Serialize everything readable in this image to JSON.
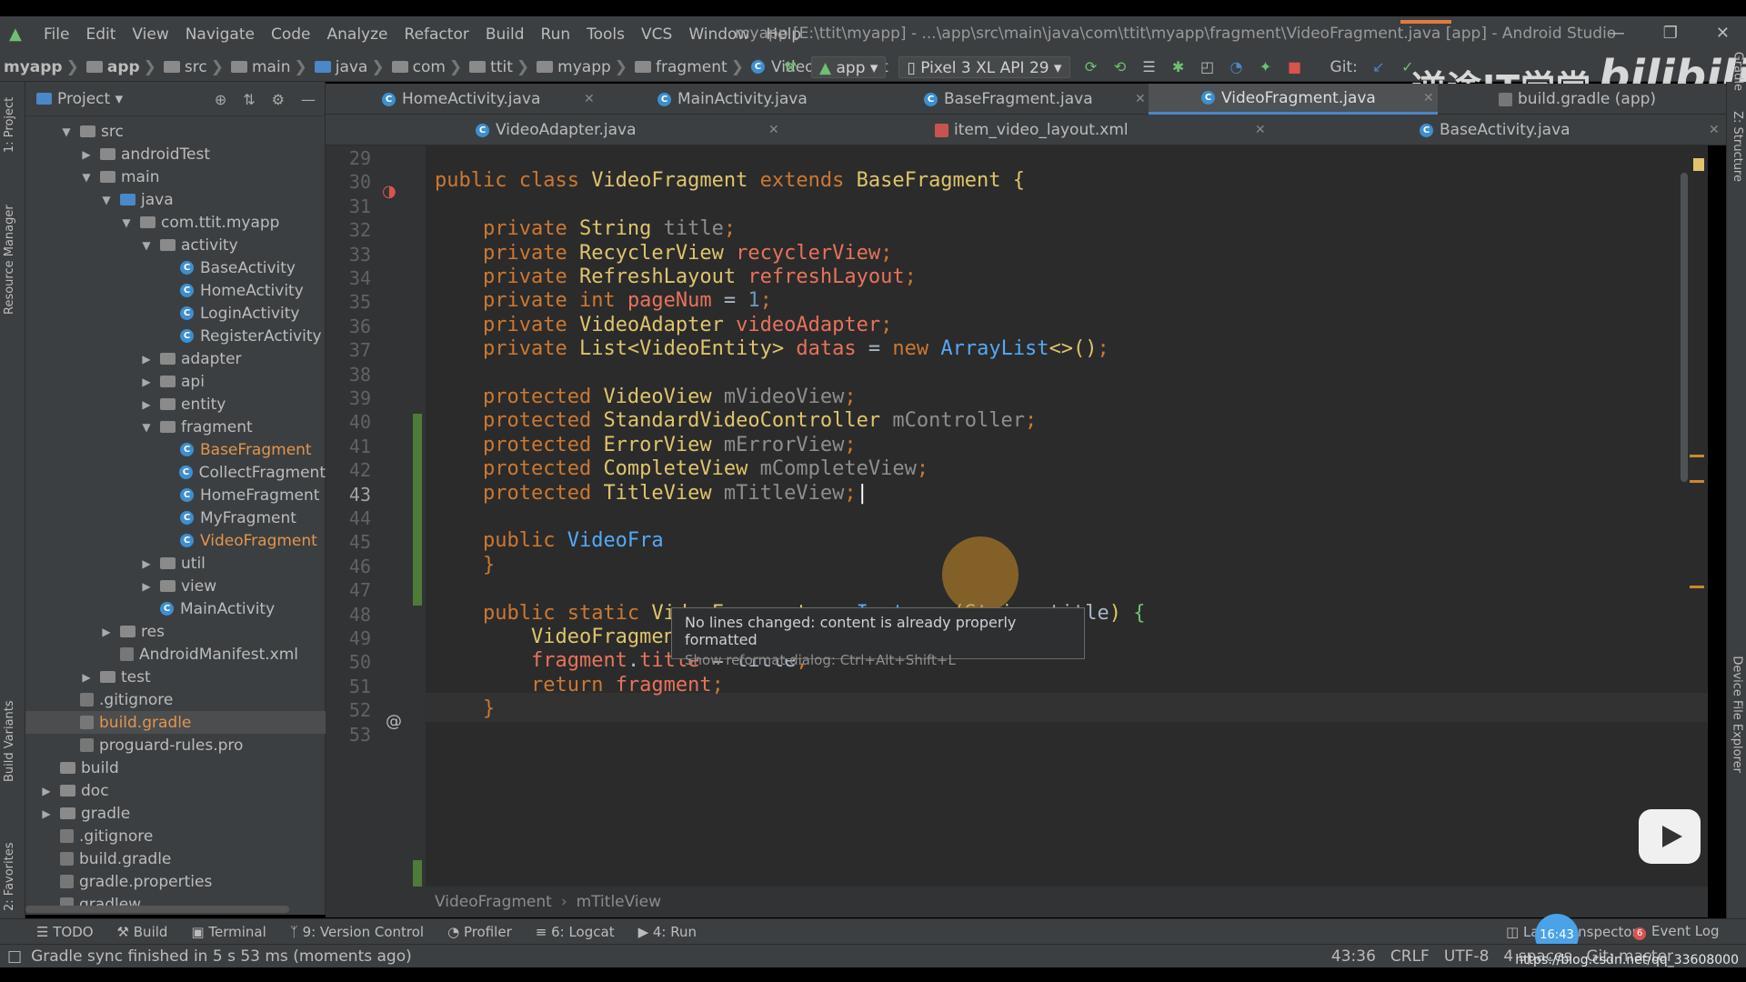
{
  "menu": [
    "File",
    "Edit",
    "View",
    "Navigate",
    "Code",
    "Analyze",
    "Refactor",
    "Build",
    "Run",
    "Tools",
    "VCS",
    "Window",
    "Help"
  ],
  "window_title": "myapp [E:\\ttit\\myapp] - ...\\app\\src\\main\\java\\com\\ttit\\myapp\\fragment\\VideoFragment.java [app] - Android Studio",
  "nav_crumbs": [
    "myapp",
    "app",
    "src",
    "main",
    "java",
    "com",
    "ttit",
    "myapp",
    "fragment",
    "VideoFragment"
  ],
  "run_config": "app",
  "device": "Pixel 3 XL API 29",
  "git_label": "Git:",
  "project_panel": {
    "title": "Project",
    "tree": [
      {
        "label": "src",
        "depth": 0,
        "kind": "folder",
        "state": "open"
      },
      {
        "label": "androidTest",
        "depth": 1,
        "kind": "folder",
        "state": "closed"
      },
      {
        "label": "main",
        "depth": 1,
        "kind": "folder",
        "state": "open"
      },
      {
        "label": "java",
        "depth": 2,
        "kind": "folder-blue",
        "state": "open"
      },
      {
        "label": "com.ttit.myapp",
        "depth": 3,
        "kind": "folder",
        "state": "open"
      },
      {
        "label": "activity",
        "depth": 4,
        "kind": "folder",
        "state": "open"
      },
      {
        "label": "BaseActivity",
        "depth": 5,
        "kind": "class",
        "state": "none"
      },
      {
        "label": "HomeActivity",
        "depth": 5,
        "kind": "class",
        "state": "none"
      },
      {
        "label": "LoginActivity",
        "depth": 5,
        "kind": "class",
        "state": "none"
      },
      {
        "label": "RegisterActivity",
        "depth": 5,
        "kind": "class",
        "state": "none"
      },
      {
        "label": "adapter",
        "depth": 4,
        "kind": "folder",
        "state": "closed"
      },
      {
        "label": "api",
        "depth": 4,
        "kind": "folder",
        "state": "closed"
      },
      {
        "label": "entity",
        "depth": 4,
        "kind": "folder",
        "state": "closed"
      },
      {
        "label": "fragment",
        "depth": 4,
        "kind": "folder",
        "state": "open"
      },
      {
        "label": "BaseFragment",
        "depth": 5,
        "kind": "class",
        "state": "none",
        "highlight": true
      },
      {
        "label": "CollectFragment",
        "depth": 5,
        "kind": "class",
        "state": "none"
      },
      {
        "label": "HomeFragment",
        "depth": 5,
        "kind": "class",
        "state": "none"
      },
      {
        "label": "MyFragment",
        "depth": 5,
        "kind": "class",
        "state": "none"
      },
      {
        "label": "VideoFragment",
        "depth": 5,
        "kind": "class",
        "state": "none",
        "highlight": true
      },
      {
        "label": "util",
        "depth": 4,
        "kind": "folder",
        "state": "closed"
      },
      {
        "label": "view",
        "depth": 4,
        "kind": "folder",
        "state": "closed"
      },
      {
        "label": "MainActivity",
        "depth": 4,
        "kind": "class",
        "state": "none"
      },
      {
        "label": "res",
        "depth": 2,
        "kind": "folder",
        "state": "closed"
      },
      {
        "label": "AndroidManifest.xml",
        "depth": 2,
        "kind": "file",
        "state": "none"
      },
      {
        "label": "test",
        "depth": 1,
        "kind": "folder",
        "state": "closed"
      },
      {
        "label": ".gitignore",
        "depth": 0,
        "kind": "file",
        "state": "none"
      },
      {
        "label": "build.gradle",
        "depth": 0,
        "kind": "file",
        "state": "none",
        "selected": true,
        "highlight": true
      },
      {
        "label": "proguard-rules.pro",
        "depth": 0,
        "kind": "file",
        "state": "none"
      },
      {
        "label": "build",
        "depth": -1,
        "kind": "folder",
        "state": "none"
      },
      {
        "label": "doc",
        "depth": -1,
        "kind": "folder",
        "state": "closed"
      },
      {
        "label": "gradle",
        "depth": -1,
        "kind": "folder",
        "state": "closed"
      },
      {
        "label": ".gitignore",
        "depth": -1,
        "kind": "file",
        "state": "none"
      },
      {
        "label": "build.gradle",
        "depth": -1,
        "kind": "file",
        "state": "none"
      },
      {
        "label": "gradle.properties",
        "depth": -1,
        "kind": "file",
        "state": "none"
      },
      {
        "label": "gradlew",
        "depth": -1,
        "kind": "file",
        "state": "none"
      }
    ]
  },
  "tabs_row1": [
    {
      "label": "HomeActivity.java",
      "active": false
    },
    {
      "label": "MainActivity.java",
      "active": false
    },
    {
      "label": "BaseFragment.java",
      "active": false
    },
    {
      "label": "VideoFragment.java",
      "active": true
    },
    {
      "label": "build.gradle (app)",
      "active": false
    }
  ],
  "tabs_row2": [
    {
      "label": "VideoAdapter.java"
    },
    {
      "label": "item_video_layout.xml"
    },
    {
      "label": "BaseActivity.java"
    }
  ],
  "editor": {
    "line_numbers": [
      "29",
      "30",
      "31",
      "32",
      "33",
      "34",
      "35",
      "36",
      "37",
      "38",
      "39",
      "40",
      "41",
      "42",
      "43",
      "44",
      "45",
      "46",
      "47",
      "48",
      "49",
      "50",
      "51",
      "52",
      "53"
    ],
    "current_line": "43"
  },
  "tooltip": {
    "main": "No lines changed: content is already properly formatted",
    "sub": "Show reformat dialog: Ctrl+Alt+Shift+L"
  },
  "code_breadcrumb": [
    "VideoFragment",
    "mTitleView"
  ],
  "bottom_tools": [
    "TODO",
    "Build",
    "Terminal",
    "9: Version Control",
    "Profiler",
    "6: Logcat",
    "4: Run"
  ],
  "bottom_right_tools": [
    "Layout Inspector",
    "Event Log"
  ],
  "event_count": "6",
  "status": {
    "message": "Gradle sync finished in 5 s 53 ms (moments ago)",
    "position": "43:36",
    "line_sep": "CRLF",
    "encoding": "UTF-8",
    "indent": "4 spaces",
    "vcs": "Git: master"
  },
  "overlay": {
    "time": "16:43",
    "watermark_text": "逆途IT学堂",
    "watermark_logo": "bilibili",
    "url": "https://blog.csdn.net/qq_33608000"
  },
  "side_labels": {
    "left": [
      "1: Project",
      "Resource Manager",
      "Build Variants",
      "2: Favorites"
    ],
    "right": [
      "Gradle",
      "Z: Structure",
      "Device File Explorer"
    ]
  },
  "colors": {
    "keyword": "#cc7832",
    "type": "#e0c46c",
    "field": "#e8725c",
    "number": "#6897bb",
    "method": "#56a8f5",
    "background": "#2b2b2b"
  }
}
